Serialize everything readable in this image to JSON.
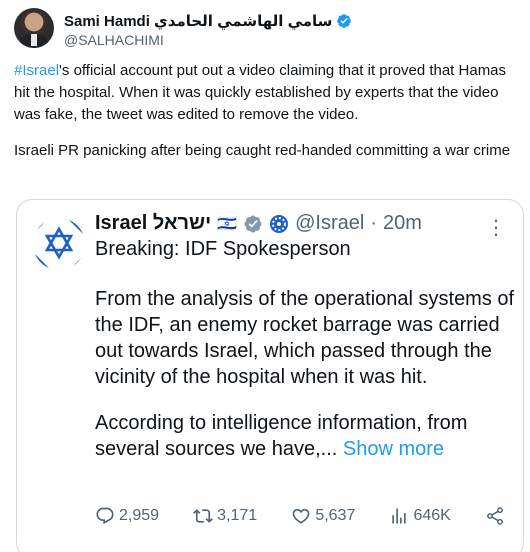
{
  "author": {
    "display_name": "Sami Hamdi سامي الهاشمي الحامدي",
    "handle": "@SALHACHIMI"
  },
  "tweet": {
    "hashtag": "#Israel",
    "paragraph1_rest": "'s official account put out a video claiming that it proved that Hamas hit the hospital. When it was quickly established by experts that the video was fake, the tweet was edited to remove the video.",
    "paragraph2": "Israeli PR panicking after being caught red-handed committing a war crime"
  },
  "quoted": {
    "name": "Israel ישראל",
    "flag": "🇮🇱",
    "handle": "@Israel",
    "separator": "·",
    "time": "20m",
    "subtitle": "Breaking: IDF Spokesperson",
    "paragraph1": "From the analysis of the operational systems of the IDF, an enemy rocket barrage was carried out towards Israel, which passed through the vicinity of the hospital when it was hit.",
    "paragraph2": "According to intelligence information, from several sources we have,...",
    "show_more": "Show more",
    "more_menu": "⋮",
    "replies": "2,959",
    "reposts": "3,171",
    "likes": "5,637",
    "views": "646K"
  },
  "colors": {
    "accent": "#1d9bf0",
    "muted": "#536471",
    "text": "#0f1419",
    "border": "#cfd9de",
    "gold": "#829aab"
  },
  "icons": [
    "verified-badge-icon",
    "gov-badge-icon",
    "reply-icon",
    "repost-icon",
    "like-icon",
    "views-icon",
    "share-icon",
    "more-icon"
  ]
}
